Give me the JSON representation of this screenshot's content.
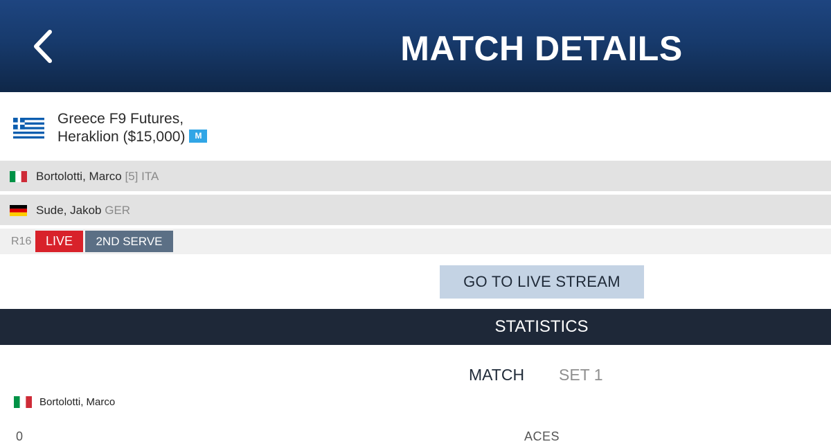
{
  "header": {
    "title": "MATCH DETAILS",
    "back_icon": "chevron-left-icon",
    "gradient_top": "#1e4580",
    "gradient_bottom": "#0f2748"
  },
  "tournament": {
    "flag": "greece-flag",
    "name_line1": "Greece F9 Futures,",
    "name_line2": "Heraklion ($15,000)",
    "badge": "M",
    "badge_color": "#31a6e6"
  },
  "players": [
    {
      "flag": "italy-flag",
      "name": "Bortolotti, Marco",
      "seed": "[5]",
      "country": "ITA"
    },
    {
      "flag": "germany-flag",
      "name": "Sude, Jakob",
      "seed": "",
      "country": "GER"
    }
  ],
  "status": {
    "round": "R16",
    "live_label": "LIVE",
    "live_color": "#d8222a",
    "serve_label": "2ND SERVE",
    "serve_color": "#5b6f85"
  },
  "live_stream_button": {
    "label": "GO TO LIVE STREAM",
    "color": "#c4d3e4"
  },
  "statistics": {
    "title": "STATISTICS",
    "bar_color": "#1e2838",
    "tabs": [
      {
        "label": "MATCH",
        "active": true
      },
      {
        "label": "SET 1",
        "active": false
      }
    ],
    "player": {
      "flag": "italy-flag",
      "name": "Bortolotti, Marco"
    },
    "first_row": {
      "value": "0",
      "label": "ACES"
    }
  }
}
